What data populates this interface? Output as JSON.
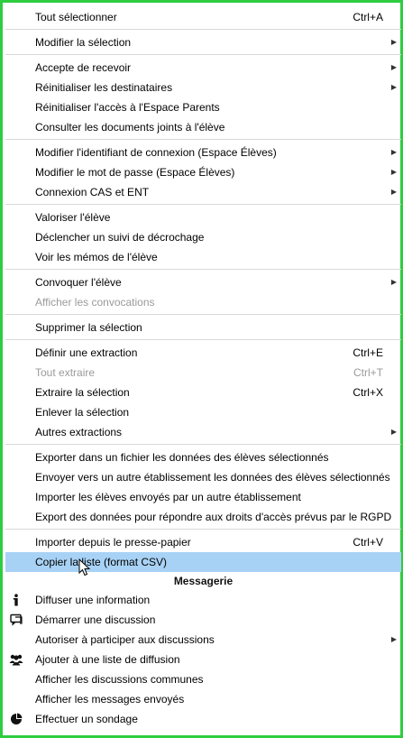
{
  "menu": {
    "items": [
      {
        "label": "Tout sélectionner",
        "shortcut": "Ctrl+A"
      },
      {
        "label": "Modifier la sélection"
      },
      {
        "label": "Accepte de recevoir"
      },
      {
        "label": "Réinitialiser les destinataires"
      },
      {
        "label": "Réinitialiser l'accès à l'Espace Parents"
      },
      {
        "label": "Consulter les documents joints à l'élève"
      },
      {
        "label": "Modifier l'identifiant de connexion (Espace Élèves)"
      },
      {
        "label": "Modifier le mot de passe (Espace Élèves)"
      },
      {
        "label": "Connexion CAS et ENT"
      },
      {
        "label": "Valoriser l'élève"
      },
      {
        "label": "Déclencher un suivi de décrochage"
      },
      {
        "label": "Voir les mémos de l'élève"
      },
      {
        "label": "Convoquer l'élève"
      },
      {
        "label": "Afficher les convocations"
      },
      {
        "label": "Supprimer la sélection"
      },
      {
        "label": "Définir une extraction",
        "shortcut": "Ctrl+E"
      },
      {
        "label": "Tout extraire",
        "shortcut": "Ctrl+T"
      },
      {
        "label": "Extraire la sélection",
        "shortcut": "Ctrl+X"
      },
      {
        "label": "Enlever la sélection"
      },
      {
        "label": "Autres extractions"
      },
      {
        "label": "Exporter dans un fichier les données des élèves sélectionnés"
      },
      {
        "label": "Envoyer vers un autre établissement les données des élèves sélectionnés"
      },
      {
        "label": "Importer les élèves envoyés par un autre établissement"
      },
      {
        "label": "Export des données pour répondre aux droits d'accès prévus par le RGPD"
      },
      {
        "label": "Importer depuis le presse-papier",
        "shortcut": "Ctrl+V"
      },
      {
        "label": "Copier la liste (format CSV)"
      }
    ],
    "section_title": "Messagerie",
    "messaging": [
      {
        "label": "Diffuser une information",
        "icon": "info-icon"
      },
      {
        "label": "Démarrer une discussion",
        "icon": "chat-icon"
      },
      {
        "label": "Autoriser à participer aux discussions"
      },
      {
        "label": "Ajouter à une liste de diffusion",
        "icon": "group-icon"
      },
      {
        "label": "Afficher les discussions communes"
      },
      {
        "label": "Afficher les messages envoyés"
      },
      {
        "label": "Effectuer un sondage",
        "icon": "pie-chart-icon"
      }
    ]
  },
  "colors": {
    "frame_border": "#2ecc40",
    "highlight": "#a8d2f5",
    "disabled_text": "#9a9a9a"
  }
}
